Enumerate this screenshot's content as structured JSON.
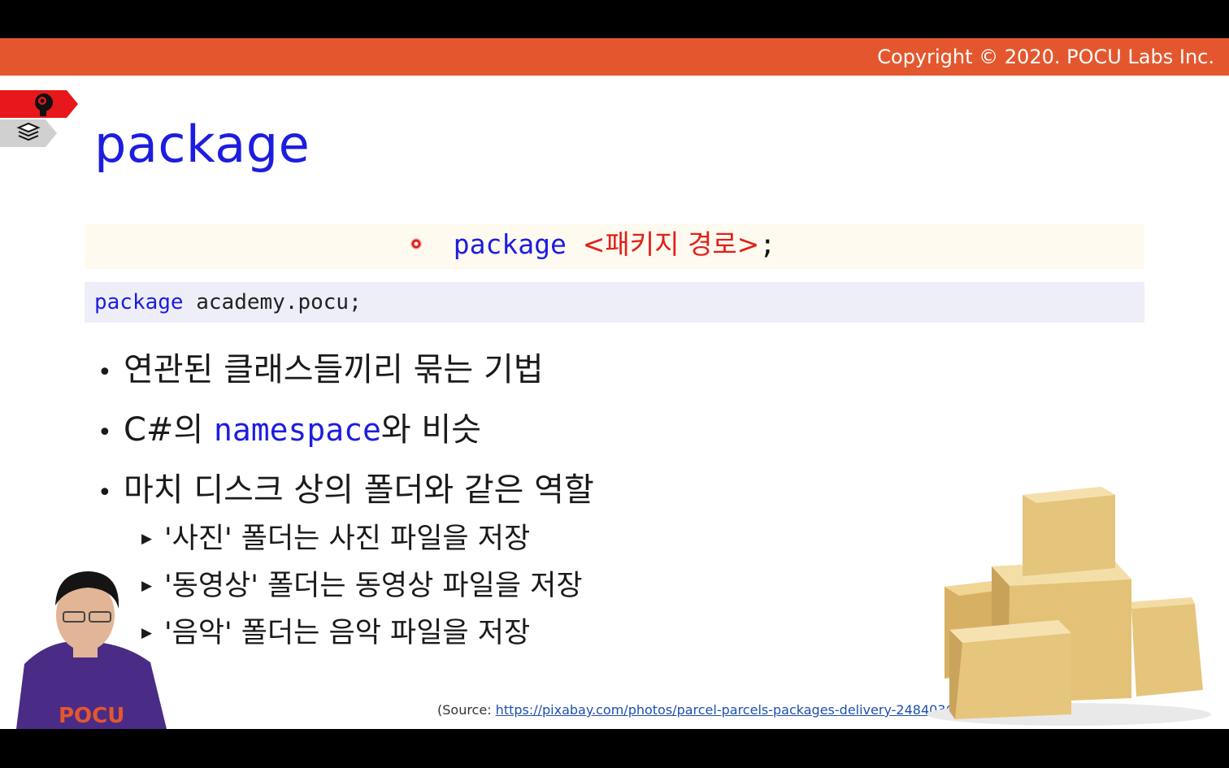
{
  "header": {
    "copyright": "Copyright © 2020. POCU Labs Inc."
  },
  "slide": {
    "title": "package",
    "syntax": {
      "keyword": "package",
      "placeholder": "<패키지 경로>",
      "terminator": ";"
    },
    "code": "package academy.pocu;",
    "code_keyword": "package",
    "code_rest": " academy.pocu;",
    "bullets": [
      {
        "text": "연관된 클래스들끼리 묶는 기법"
      },
      {
        "prefix": "C#의 ",
        "highlight": "namespace",
        "suffix": "와 비슷"
      },
      {
        "text": "마치 디스크 상의 폴더와 같은 역할"
      }
    ],
    "sub_bullets": [
      "'사진' 폴더는 사진 파일을 저장",
      "'동영상' 폴더는 동영상 파일을 저장",
      "'음악' 폴더는 음악 파일을 저장"
    ],
    "source_prefix": "(Source: ",
    "source_link": "https://pixabay.com/photos/parcel-parcels-packages-delivery-2484036/",
    "source_suffix": ")",
    "shirt_logo_text": "POCU"
  },
  "colors": {
    "header": "#e4572e",
    "title": "#1d1de0",
    "placeholder": "#e0201a",
    "nav_active": "#e8171b",
    "nav_inactive": "#c8c8c8",
    "code_bg": "#eeeef9",
    "syntax_bg": "#fefaf0",
    "box": "#e3c277"
  },
  "icons": [
    "brain-head-icon",
    "books-stack-icon",
    "bullet-dot-icon",
    "triangle-bullet-icon"
  ]
}
